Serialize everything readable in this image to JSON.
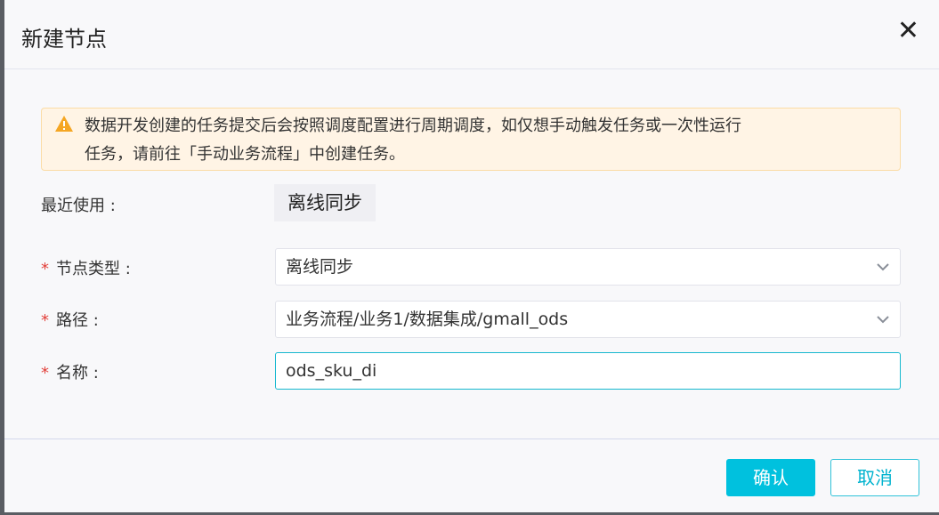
{
  "dialog": {
    "title": "新建节点",
    "close_icon": "close-icon"
  },
  "notice": {
    "icon": "warning-triangle-icon",
    "line1": "数据开发创建的任务提交后会按照调度配置进行周期调度，如仅想手动触发任务或一次性运行",
    "line2": "任务，请前往「手动业务流程」中创建任务。",
    "color": "#fff4e5"
  },
  "recent": {
    "label": "最近使用 :",
    "item": "离线同步"
  },
  "form": {
    "required_mark": "*",
    "node_type": {
      "label": "节点类型 :",
      "value": "离线同步"
    },
    "path": {
      "label": "路径 :",
      "value": "业务流程/业务1/数据集成/gmall_ods"
    },
    "name": {
      "label": "名称 :",
      "value": "ods_sku_di"
    }
  },
  "footer": {
    "confirm": "确认",
    "cancel": "取消",
    "accent": "#00c1de"
  }
}
